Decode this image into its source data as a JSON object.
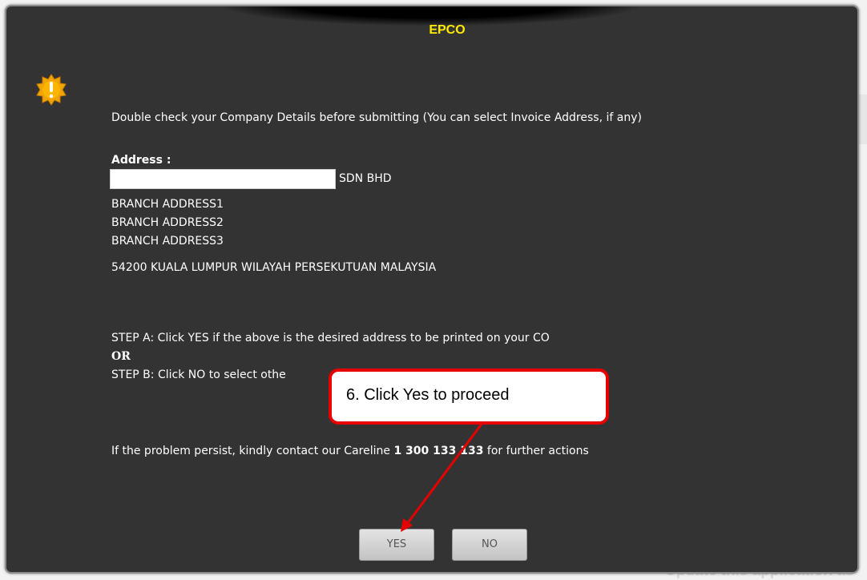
{
  "background": {
    "partial_text": "Update this application as"
  },
  "dialog": {
    "title": "EPCO",
    "icon": "warning-icon",
    "accent_color": "#ffea00",
    "message": "Double check your Company Details before submitting (You can select Invoice Address, if any)",
    "address_label": "Address :",
    "address_name_suffix": "SDN BHD",
    "address_lines": [
      "BRANCH ADDRESS1",
      "BRANCH ADDRESS2",
      "BRANCH ADDRESS3",
      "54200 KUALA LUMPUR WILAYAH PERSEKUTUAN MALAYSIA"
    ],
    "step_a": "STEP A: Click YES if the above is the desired address to be printed on your CO",
    "or_text": "OR",
    "step_b_visible": "STEP B: Click NO to select othe",
    "contact_prefix": "If the problem persist, kindly contact our Careline ",
    "contact_number": "1 300 133 133",
    "contact_suffix": " for further actions",
    "yes_label": "YES",
    "no_label": "NO"
  },
  "annotation": {
    "text": "6.   Click Yes to proceed",
    "color": "#e60000"
  }
}
